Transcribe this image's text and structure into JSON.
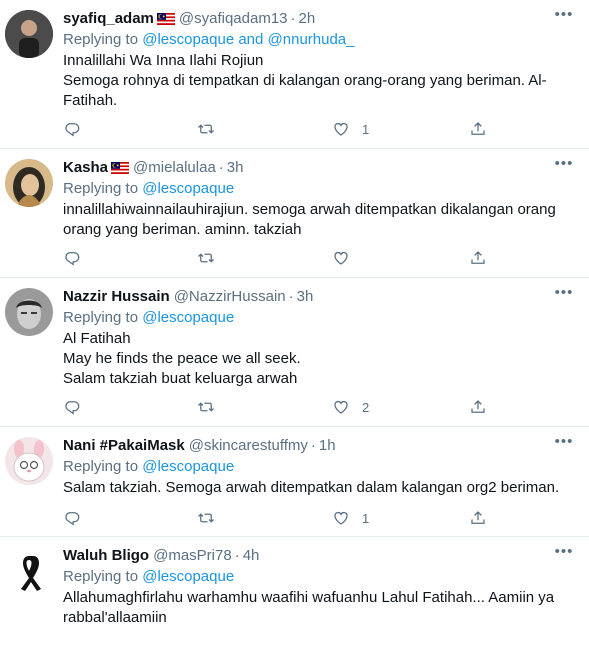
{
  "feed": {
    "tweets": [
      {
        "name": "syafiq_adam",
        "handle": "@syafiqadam13",
        "dot": "·",
        "time": "2h",
        "flag": "malaysia-flag",
        "replying_prefix": "Replying to ",
        "replying_to": "@lescopaque and @nnurhuda_",
        "lines": [
          "Innalillahi Wa Inna Ilahi Rojiun",
          "Semoga rohnya di tempatkan di kalangan orang-orang yang beriman. Al-",
          "Fatihah."
        ],
        "like_count": "1"
      },
      {
        "name": "Kasha",
        "handle": "@mielalulaa",
        "dot": "·",
        "time": "3h",
        "flag": "malaysia-flag",
        "replying_prefix": "Replying to ",
        "replying_to": "@lescopaque",
        "lines": [
          "innalillahiwainnailauhirajiun. semoga arwah ditempatkan dikalangan orang",
          "orang yang beriman. aminn. takziah"
        ],
        "like_count": ""
      },
      {
        "name": "Nazzir Hussain",
        "handle": "@NazzirHussain",
        "dot": "·",
        "time": "3h",
        "flag": "",
        "replying_prefix": "Replying to ",
        "replying_to": "@lescopaque",
        "lines": [
          "Al Fatihah",
          "May he finds the peace we all seek.",
          "Salam takziah buat keluarga arwah"
        ],
        "like_count": "2"
      },
      {
        "name": "Nani #PakaiMask",
        "handle": "@skincarestuffmy",
        "dot": "·",
        "time": "1h",
        "flag": "",
        "replying_prefix": "Replying to ",
        "replying_to": "@lescopaque",
        "lines": [
          "Salam takziah. Semoga arwah ditempatkan dalam kalangan org2 beriman."
        ],
        "like_count": "1"
      },
      {
        "name": "Waluh Bligo",
        "handle": "@masPri78",
        "dot": "·",
        "time": "4h",
        "flag": "",
        "replying_prefix": "Replying to ",
        "replying_to": "@lescopaque",
        "lines": [
          "Allahumaghfirlahu warhamhu waafihi wafuanhu Lahul Fatihah... Aamiin ya",
          "rabbal'allaamiin"
        ],
        "like_count": ""
      }
    ]
  },
  "icons": {
    "reply": "reply-icon",
    "retweet": "retweet-icon",
    "like": "like-icon",
    "share": "share-icon",
    "more": "more-options-icon"
  },
  "colors": {
    "link": "#1b95e0",
    "secondary_text": "#5b7083",
    "divider": "#e6ecf0"
  }
}
